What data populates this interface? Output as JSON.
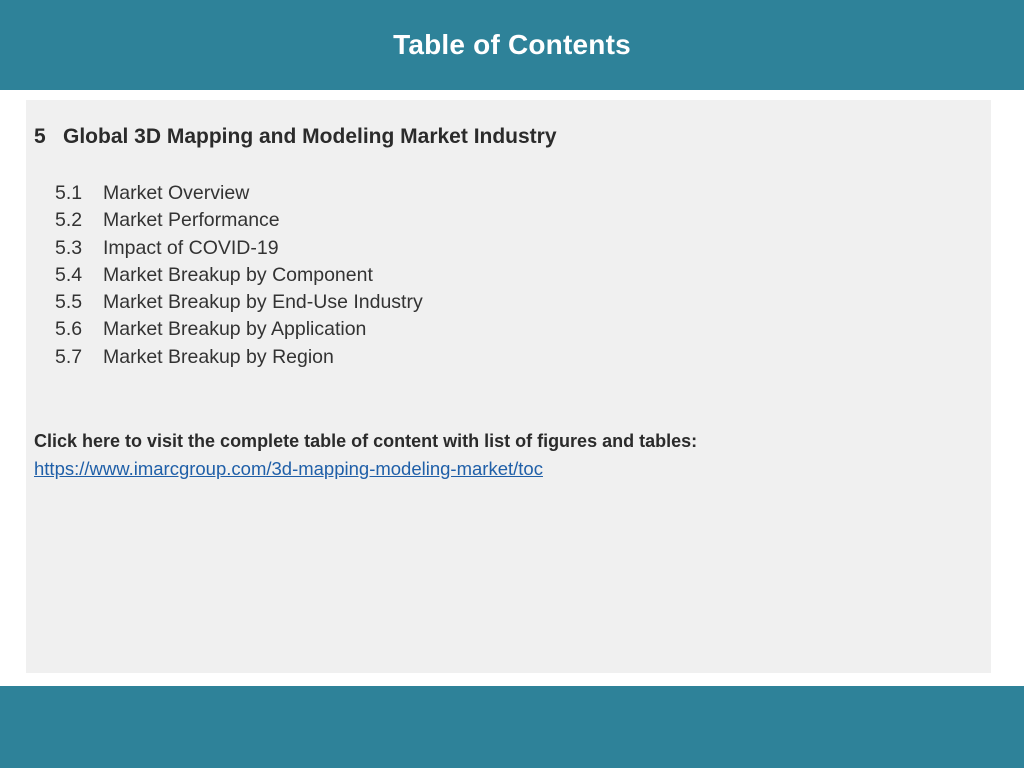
{
  "header": {
    "title": "Table of Contents"
  },
  "section": {
    "number": "5",
    "title": "Global 3D Mapping and Modeling Market Industry",
    "items": [
      {
        "number": "5.1",
        "label": "Market Overview"
      },
      {
        "number": "5.2",
        "label": "Market Performance"
      },
      {
        "number": "5.3",
        "label": "Impact of COVID-19"
      },
      {
        "number": "5.4",
        "label": "Market Breakup by Component"
      },
      {
        "number": "5.5",
        "label": "Market Breakup by End-Use Industry"
      },
      {
        "number": "5.6",
        "label": "Market Breakup by Application"
      },
      {
        "number": "5.7",
        "label": "Market Breakup by Region"
      }
    ]
  },
  "cta": {
    "text": "Click here to visit the complete table of content with list of figures and tables:",
    "link_text": "https://www.imarcgroup.com/3d-mapping-modeling-market/toc"
  },
  "colors": {
    "header_bg": "#2e8299",
    "panel_bg": "#f0f0f0",
    "link": "#1f5fa8"
  }
}
